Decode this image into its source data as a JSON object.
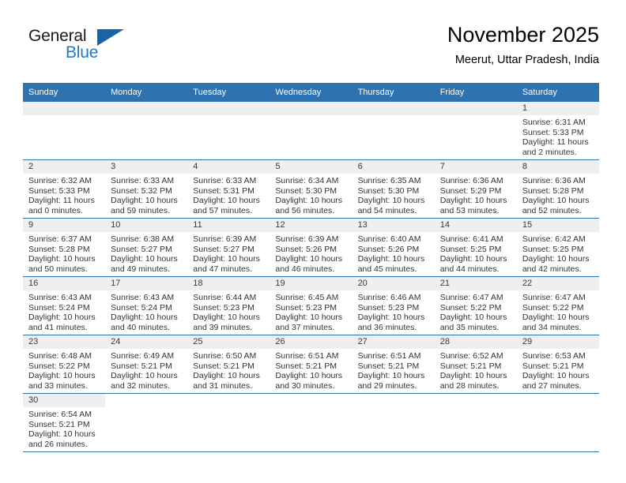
{
  "brand": {
    "word1": "General",
    "word2": "Blue",
    "triangle_color": "#1565a8",
    "blue_color": "#1f7ac4"
  },
  "header": {
    "month_title": "November 2025",
    "location": "Meerut, Uttar Pradesh, India"
  },
  "theme": {
    "header_bg": "#2e72b0",
    "daynum_band_bg": "#efefef",
    "rule_color": "#2e72b0"
  },
  "weekdays": [
    "Sunday",
    "Monday",
    "Tuesday",
    "Wednesday",
    "Thursday",
    "Friday",
    "Saturday"
  ],
  "weeks": [
    [
      {
        "type": "blank"
      },
      {
        "type": "blank"
      },
      {
        "type": "blank"
      },
      {
        "type": "blank"
      },
      {
        "type": "blank"
      },
      {
        "type": "blank"
      },
      {
        "type": "day",
        "day": "1",
        "sunrise": "Sunrise: 6:31 AM",
        "sunset": "Sunset: 5:33 PM",
        "daylight1": "Daylight: 11 hours",
        "daylight2": "and 2 minutes."
      }
    ],
    [
      {
        "type": "day",
        "day": "2",
        "sunrise": "Sunrise: 6:32 AM",
        "sunset": "Sunset: 5:33 PM",
        "daylight1": "Daylight: 11 hours",
        "daylight2": "and 0 minutes."
      },
      {
        "type": "day",
        "day": "3",
        "sunrise": "Sunrise: 6:33 AM",
        "sunset": "Sunset: 5:32 PM",
        "daylight1": "Daylight: 10 hours",
        "daylight2": "and 59 minutes."
      },
      {
        "type": "day",
        "day": "4",
        "sunrise": "Sunrise: 6:33 AM",
        "sunset": "Sunset: 5:31 PM",
        "daylight1": "Daylight: 10 hours",
        "daylight2": "and 57 minutes."
      },
      {
        "type": "day",
        "day": "5",
        "sunrise": "Sunrise: 6:34 AM",
        "sunset": "Sunset: 5:30 PM",
        "daylight1": "Daylight: 10 hours",
        "daylight2": "and 56 minutes."
      },
      {
        "type": "day",
        "day": "6",
        "sunrise": "Sunrise: 6:35 AM",
        "sunset": "Sunset: 5:30 PM",
        "daylight1": "Daylight: 10 hours",
        "daylight2": "and 54 minutes."
      },
      {
        "type": "day",
        "day": "7",
        "sunrise": "Sunrise: 6:36 AM",
        "sunset": "Sunset: 5:29 PM",
        "daylight1": "Daylight: 10 hours",
        "daylight2": "and 53 minutes."
      },
      {
        "type": "day",
        "day": "8",
        "sunrise": "Sunrise: 6:36 AM",
        "sunset": "Sunset: 5:28 PM",
        "daylight1": "Daylight: 10 hours",
        "daylight2": "and 52 minutes."
      }
    ],
    [
      {
        "type": "day",
        "day": "9",
        "sunrise": "Sunrise: 6:37 AM",
        "sunset": "Sunset: 5:28 PM",
        "daylight1": "Daylight: 10 hours",
        "daylight2": "and 50 minutes."
      },
      {
        "type": "day",
        "day": "10",
        "sunrise": "Sunrise: 6:38 AM",
        "sunset": "Sunset: 5:27 PM",
        "daylight1": "Daylight: 10 hours",
        "daylight2": "and 49 minutes."
      },
      {
        "type": "day",
        "day": "11",
        "sunrise": "Sunrise: 6:39 AM",
        "sunset": "Sunset: 5:27 PM",
        "daylight1": "Daylight: 10 hours",
        "daylight2": "and 47 minutes."
      },
      {
        "type": "day",
        "day": "12",
        "sunrise": "Sunrise: 6:39 AM",
        "sunset": "Sunset: 5:26 PM",
        "daylight1": "Daylight: 10 hours",
        "daylight2": "and 46 minutes."
      },
      {
        "type": "day",
        "day": "13",
        "sunrise": "Sunrise: 6:40 AM",
        "sunset": "Sunset: 5:26 PM",
        "daylight1": "Daylight: 10 hours",
        "daylight2": "and 45 minutes."
      },
      {
        "type": "day",
        "day": "14",
        "sunrise": "Sunrise: 6:41 AM",
        "sunset": "Sunset: 5:25 PM",
        "daylight1": "Daylight: 10 hours",
        "daylight2": "and 44 minutes."
      },
      {
        "type": "day",
        "day": "15",
        "sunrise": "Sunrise: 6:42 AM",
        "sunset": "Sunset: 5:25 PM",
        "daylight1": "Daylight: 10 hours",
        "daylight2": "and 42 minutes."
      }
    ],
    [
      {
        "type": "day",
        "day": "16",
        "sunrise": "Sunrise: 6:43 AM",
        "sunset": "Sunset: 5:24 PM",
        "daylight1": "Daylight: 10 hours",
        "daylight2": "and 41 minutes."
      },
      {
        "type": "day",
        "day": "17",
        "sunrise": "Sunrise: 6:43 AM",
        "sunset": "Sunset: 5:24 PM",
        "daylight1": "Daylight: 10 hours",
        "daylight2": "and 40 minutes."
      },
      {
        "type": "day",
        "day": "18",
        "sunrise": "Sunrise: 6:44 AM",
        "sunset": "Sunset: 5:23 PM",
        "daylight1": "Daylight: 10 hours",
        "daylight2": "and 39 minutes."
      },
      {
        "type": "day",
        "day": "19",
        "sunrise": "Sunrise: 6:45 AM",
        "sunset": "Sunset: 5:23 PM",
        "daylight1": "Daylight: 10 hours",
        "daylight2": "and 37 minutes."
      },
      {
        "type": "day",
        "day": "20",
        "sunrise": "Sunrise: 6:46 AM",
        "sunset": "Sunset: 5:23 PM",
        "daylight1": "Daylight: 10 hours",
        "daylight2": "and 36 minutes."
      },
      {
        "type": "day",
        "day": "21",
        "sunrise": "Sunrise: 6:47 AM",
        "sunset": "Sunset: 5:22 PM",
        "daylight1": "Daylight: 10 hours",
        "daylight2": "and 35 minutes."
      },
      {
        "type": "day",
        "day": "22",
        "sunrise": "Sunrise: 6:47 AM",
        "sunset": "Sunset: 5:22 PM",
        "daylight1": "Daylight: 10 hours",
        "daylight2": "and 34 minutes."
      }
    ],
    [
      {
        "type": "day",
        "day": "23",
        "sunrise": "Sunrise: 6:48 AM",
        "sunset": "Sunset: 5:22 PM",
        "daylight1": "Daylight: 10 hours",
        "daylight2": "and 33 minutes."
      },
      {
        "type": "day",
        "day": "24",
        "sunrise": "Sunrise: 6:49 AM",
        "sunset": "Sunset: 5:21 PM",
        "daylight1": "Daylight: 10 hours",
        "daylight2": "and 32 minutes."
      },
      {
        "type": "day",
        "day": "25",
        "sunrise": "Sunrise: 6:50 AM",
        "sunset": "Sunset: 5:21 PM",
        "daylight1": "Daylight: 10 hours",
        "daylight2": "and 31 minutes."
      },
      {
        "type": "day",
        "day": "26",
        "sunrise": "Sunrise: 6:51 AM",
        "sunset": "Sunset: 5:21 PM",
        "daylight1": "Daylight: 10 hours",
        "daylight2": "and 30 minutes."
      },
      {
        "type": "day",
        "day": "27",
        "sunrise": "Sunrise: 6:51 AM",
        "sunset": "Sunset: 5:21 PM",
        "daylight1": "Daylight: 10 hours",
        "daylight2": "and 29 minutes."
      },
      {
        "type": "day",
        "day": "28",
        "sunrise": "Sunrise: 6:52 AM",
        "sunset": "Sunset: 5:21 PM",
        "daylight1": "Daylight: 10 hours",
        "daylight2": "and 28 minutes."
      },
      {
        "type": "day",
        "day": "29",
        "sunrise": "Sunrise: 6:53 AM",
        "sunset": "Sunset: 5:21 PM",
        "daylight1": "Daylight: 10 hours",
        "daylight2": "and 27 minutes."
      }
    ],
    [
      {
        "type": "day",
        "day": "30",
        "sunrise": "Sunrise: 6:54 AM",
        "sunset": "Sunset: 5:21 PM",
        "daylight1": "Daylight: 10 hours",
        "daylight2": "and 26 minutes."
      },
      {
        "type": "blank"
      },
      {
        "type": "blank"
      },
      {
        "type": "blank"
      },
      {
        "type": "blank"
      },
      {
        "type": "blank"
      },
      {
        "type": "blank"
      }
    ]
  ]
}
